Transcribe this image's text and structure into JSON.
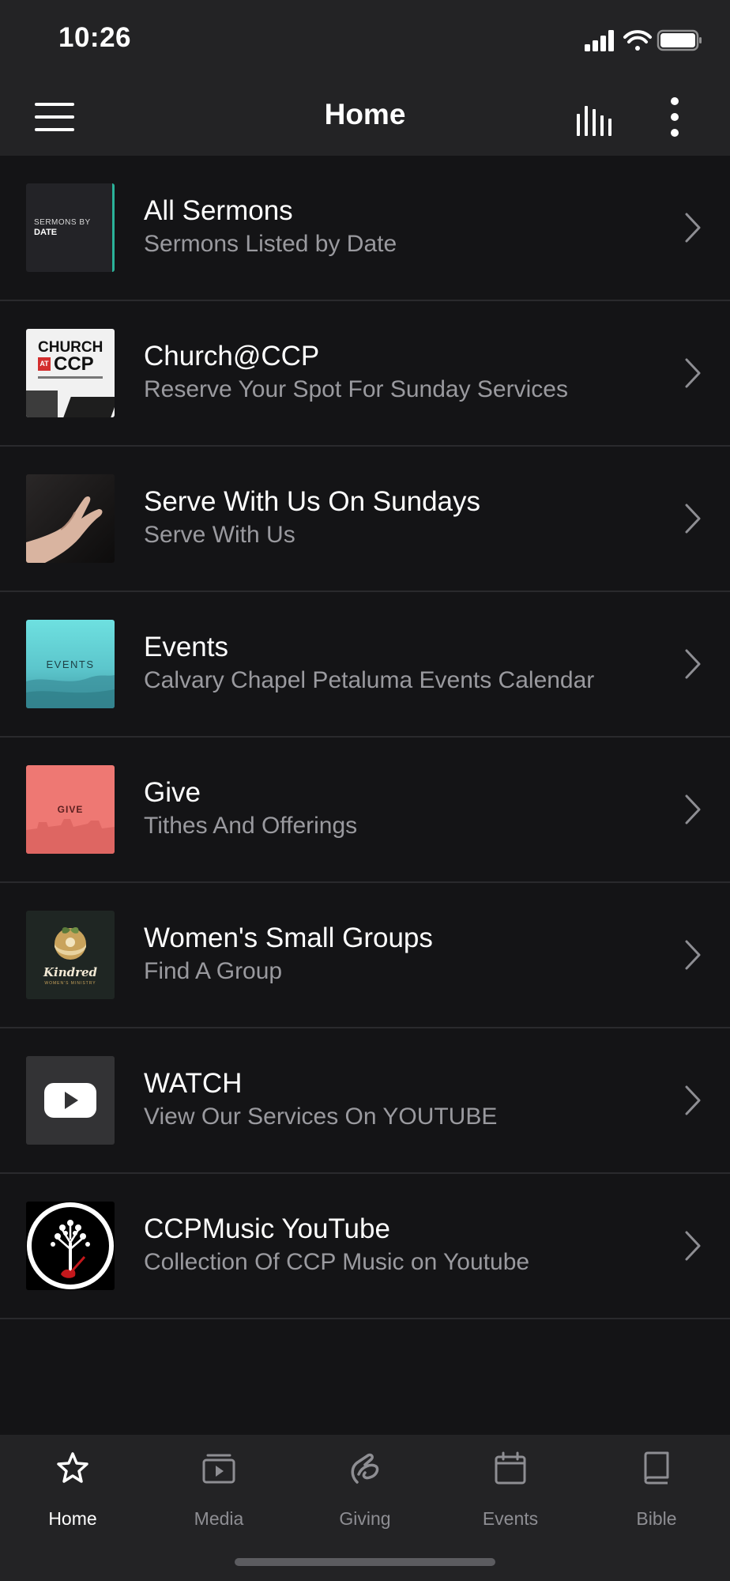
{
  "status": {
    "time": "10:26"
  },
  "nav": {
    "title": "Home"
  },
  "items": [
    {
      "title": "All Sermons",
      "subtitle": "Sermons Listed by Date",
      "thumb_text": [
        "SERMONS BY",
        "DATE"
      ]
    },
    {
      "title": "Church@CCP",
      "subtitle": "Reserve Your Spot For Sunday Services",
      "thumb_text": [
        "CHURCH",
        "AT",
        "CCP"
      ]
    },
    {
      "title": "Serve With Us On Sundays",
      "subtitle": "Serve With Us"
    },
    {
      "title": "Events",
      "subtitle": "Calvary Chapel Petaluma Events Calendar",
      "thumb_text": [
        "EVENTS"
      ]
    },
    {
      "title": "Give",
      "subtitle": "Tithes And Offerings",
      "thumb_text": [
        "GIVE"
      ]
    },
    {
      "title": "Women's Small Groups",
      "subtitle": "Find A Group",
      "thumb_text": [
        "Kindred",
        "WOMEN'S MINISTRY"
      ]
    },
    {
      "title": "WATCH",
      "subtitle": "View Our Services On YOUTUBE"
    },
    {
      "title": "CCPMusic YouTube",
      "subtitle": "Collection Of CCP Music on Youtube"
    }
  ],
  "tabs": [
    {
      "label": "Home",
      "icon": "star-icon",
      "active": true
    },
    {
      "label": "Media",
      "icon": "media-icon",
      "active": false
    },
    {
      "label": "Giving",
      "icon": "giving-icon",
      "active": false
    },
    {
      "label": "Events",
      "icon": "calendar-icon",
      "active": false
    },
    {
      "label": "Bible",
      "icon": "book-icon",
      "active": false
    }
  ],
  "colors": {
    "background": "#141416",
    "bar": "#232325",
    "subtitle": "#9a9a9f",
    "inactive_tab": "#8e8e93"
  }
}
